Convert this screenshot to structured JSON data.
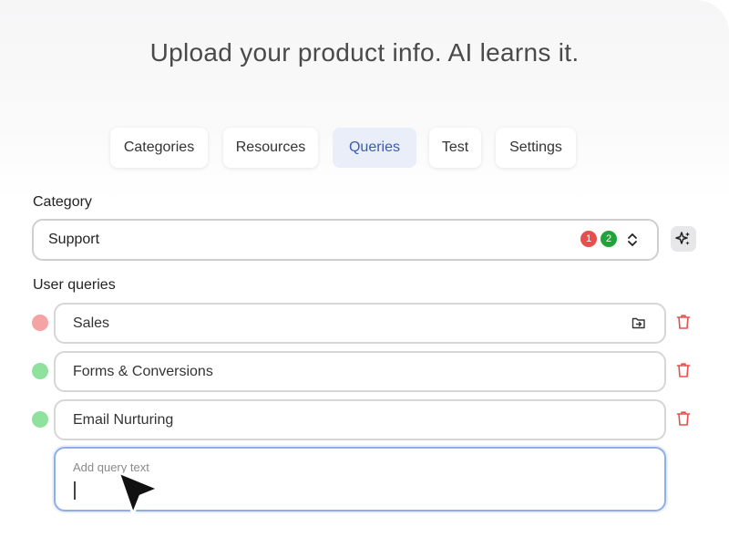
{
  "headline": "Upload your product info. AI learns it.",
  "tabs": [
    {
      "label": "Categories",
      "active": false
    },
    {
      "label": "Resources",
      "active": false
    },
    {
      "label": "Queries",
      "active": true
    },
    {
      "label": "Test",
      "active": false
    },
    {
      "label": "Settings",
      "active": false
    }
  ],
  "category": {
    "label": "Category",
    "selected": "Support",
    "badges": [
      {
        "count": "1",
        "color": "#e5504f"
      },
      {
        "count": "2",
        "color": "#22a33a"
      }
    ],
    "chevron_icon": "chevron-up-down-icon",
    "magic_icon": "sparkles-icon"
  },
  "queries": {
    "label": "User queries",
    "items": [
      {
        "text": "Sales",
        "status_color": "#f5a3a3",
        "has_move_icon": true
      },
      {
        "text": "Forms & Conversions",
        "status_color": "#8ee29d",
        "has_move_icon": false
      },
      {
        "text": "Email Nurturing",
        "status_color": "#8ee29d",
        "has_move_icon": false
      }
    ],
    "delete_icon": "trash-icon",
    "delete_color": "#e5504f",
    "add_placeholder": "Add query text"
  },
  "colors": {
    "accent": "#3b5bb0",
    "active_tab_bg": "#e9eef9",
    "focus_border": "#8faee6"
  }
}
